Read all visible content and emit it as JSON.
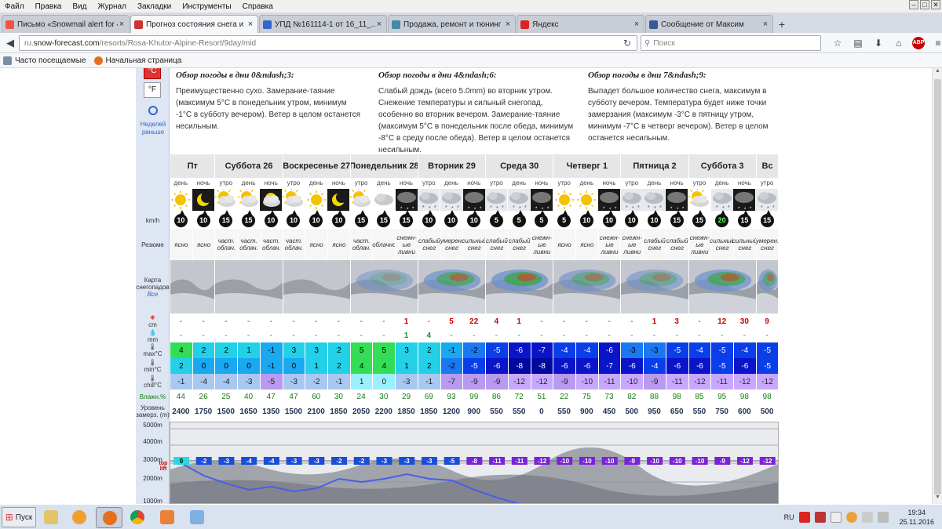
{
  "menu": [
    "Файл",
    "Правка",
    "Вид",
    "Журнал",
    "Закладки",
    "Инструменты",
    "Справка"
  ],
  "tabs": [
    {
      "label": "Письмо «Snowmail alert for 4...",
      "color": "#e54",
      "active": false
    },
    {
      "label": "Прогноз состояния снега и ...",
      "color": "#c33",
      "active": true
    },
    {
      "label": "УПД №161114-1 от 16_11_...",
      "color": "#36c",
      "active": false
    },
    {
      "label": "Продажа, ремонт и тюнинг ...",
      "color": "#48a",
      "active": false
    },
    {
      "label": "Яндекс",
      "color": "#d22",
      "active": false
    },
    {
      "label": "Сообщение от Максим",
      "color": "#3b5998",
      "active": false
    }
  ],
  "url": {
    "prefix": "ru.",
    "host": "snow-forecast.com",
    "path": "/resorts/Rosa-Khutor-Alpine-Resort/9day/mid"
  },
  "search_placeholder": "Поиск",
  "bookmarks": [
    "Часто посещаемые",
    "Начальная страница"
  ],
  "units": {
    "c": "°C",
    "f": "°F"
  },
  "prev_days": "Неделей раньше",
  "overview": [
    {
      "title": "Обзор погоды в дни 0&ndash;3:",
      "text": "Преимущественно сухо. Замерание-таяние (максимум 5°C в понедельник утром, минимум -1°C в субботу вечером). Ветер в целом останется несильным."
    },
    {
      "title": "Обзор погоды в дни 4&ndash;6:",
      "text": "Слабый дождь (всего 5.0mm) во вторник утром. Снежение температуры и сильный снегопад, особенно во вторник вечером. Замерание-таяние (максимум 5°C в понедельник после обеда, минимум -8°C в среду после обеда). Ветер в целом останется несильным."
    },
    {
      "title": "Обзор погоды в дни 7&ndash;9:",
      "text": "Выпадет большое количество снега, максимум в субботу вечером. Температура будет ниже точки замерзания (максимум -3°C в пятницу утром, минимум -7°C в четверг вечером). Ветер в целом останется несильным."
    }
  ],
  "row_labels": {
    "wind": "km/h",
    "summary": "Резюме",
    "map": "Карта снегопадов",
    "map_all": "Все",
    "snow": "cm",
    "rain": "mm",
    "tmax": "max°C",
    "tmin": "min°C",
    "chill": "chill°C",
    "hum": "Влажн.%",
    "frz": "Уровень замерз. (m)"
  },
  "days": [
    {
      "name": "Пт",
      "periods": 2
    },
    {
      "name": "Суббота 26",
      "periods": 3
    },
    {
      "name": "Воскресенье 27",
      "periods": 3
    },
    {
      "name": "Понедельник 28",
      "periods": 3
    },
    {
      "name": "Вторник 29",
      "periods": 3
    },
    {
      "name": "Среда 30",
      "periods": 3
    },
    {
      "name": "Четверг 1",
      "periods": 3
    },
    {
      "name": "Пятница 2",
      "periods": 3
    },
    {
      "name": "Суббота 3",
      "periods": 3
    },
    {
      "name": "Вс",
      "periods": 1
    }
  ],
  "columns": [
    {
      "tod": "день",
      "icon": "sun",
      "wind": "10",
      "sum": "ясно",
      "snow": "-",
      "rain": "-",
      "tmax": "4",
      "tmin": "2",
      "chill": "-1",
      "hum": "44",
      "frz": "2400"
    },
    {
      "tod": "ночь",
      "icon": "moon",
      "wind": "10",
      "sum": "ясно",
      "snow": "-",
      "rain": "-",
      "tmax": "2",
      "tmin": "0",
      "chill": "-4",
      "hum": "26",
      "frz": "1750"
    },
    {
      "tod": "утро",
      "icon": "sun-cloud",
      "wind": "15",
      "sum": "част. облач.",
      "snow": "-",
      "rain": "-",
      "tmax": "2",
      "tmin": "0",
      "chill": "-4",
      "hum": "25",
      "frz": "1500"
    },
    {
      "tod": "день",
      "icon": "sun-cloud",
      "wind": "15",
      "sum": "част. облач.",
      "snow": "-",
      "rain": "-",
      "tmax": "1",
      "tmin": "0",
      "chill": "-3",
      "hum": "40",
      "frz": "1650"
    },
    {
      "tod": "ночь",
      "icon": "moon-cloud",
      "wind": "10",
      "sum": "част. облач.",
      "snow": "-",
      "rain": "-",
      "tmax": "-1",
      "tmin": "-1",
      "chill": "-5",
      "hum": "47",
      "frz": "1350"
    },
    {
      "tod": "утро",
      "icon": "sun-cloud",
      "wind": "10",
      "sum": "част. облач.",
      "snow": "-",
      "rain": "-",
      "tmax": "3",
      "tmin": "0",
      "chill": "-3",
      "hum": "47",
      "frz": "1500"
    },
    {
      "tod": "день",
      "icon": "sun",
      "wind": "10",
      "sum": "ясно",
      "snow": "-",
      "rain": "-",
      "tmax": "3",
      "tmin": "1",
      "chill": "-2",
      "hum": "60",
      "frz": "2100"
    },
    {
      "tod": "ночь",
      "icon": "moon",
      "wind": "10",
      "sum": "ясно",
      "snow": "-",
      "rain": "-",
      "tmax": "2",
      "tmin": "2",
      "chill": "-1",
      "hum": "30",
      "frz": "1850"
    },
    {
      "tod": "утро",
      "icon": "sun-cloud",
      "wind": "15",
      "sum": "част. облач.",
      "snow": "-",
      "rain": "-",
      "tmax": "5",
      "tmin": "4",
      "chill": "1",
      "hum": "24",
      "frz": "2050"
    },
    {
      "tod": "день",
      "icon": "cloud",
      "wind": "15",
      "sum": "облачно",
      "snow": "-",
      "rain": "-",
      "tmax": "5",
      "tmin": "4",
      "chill": "0",
      "hum": "30",
      "frz": "2200"
    },
    {
      "tod": "ночь",
      "icon": "snow-night",
      "wind": "15",
      "sum": "снежн-ые ливни",
      "snow": "1",
      "rain": "1",
      "tmax": "3",
      "tmin": "1",
      "chill": "-3",
      "hum": "29",
      "frz": "1850"
    },
    {
      "tod": "утро",
      "icon": "snow",
      "wind": "10",
      "sum": "слабый снег",
      "snow": "-",
      "rain": "4",
      "tmax": "2",
      "tmin": "2",
      "chill": "-1",
      "hum": "69",
      "frz": "1850"
    },
    {
      "tod": "день",
      "icon": "snow",
      "wind": "10",
      "sum": "умерен. снег",
      "snow": "5",
      "rain": "-",
      "tmax": "-1",
      "tmin": "-2",
      "chill": "-7",
      "hum": "93",
      "frz": "1200"
    },
    {
      "tod": "ночь",
      "icon": "snow-night",
      "wind": "10",
      "sum": "сильный снег",
      "snow": "22",
      "rain": "-",
      "tmax": "-2",
      "tmin": "-5",
      "chill": "-9",
      "hum": "99",
      "frz": "900"
    },
    {
      "tod": "утро",
      "icon": "snow",
      "wind": "5",
      "sum": "слабый снег",
      "snow": "4",
      "rain": "-",
      "tmax": "-5",
      "tmin": "-6",
      "chill": "-9",
      "hum": "86",
      "frz": "550"
    },
    {
      "tod": "день",
      "icon": "snow",
      "wind": "5",
      "sum": "слабый снег",
      "snow": "1",
      "rain": "-",
      "tmax": "-6",
      "tmin": "-8",
      "chill": "-12",
      "hum": "72",
      "frz": "550"
    },
    {
      "tod": "ночь",
      "icon": "snow-night",
      "wind": "5",
      "sum": "снежн-ые ливни",
      "snow": "-",
      "rain": "-",
      "tmax": "-7",
      "tmin": "-8",
      "chill": "-12",
      "hum": "51",
      "frz": "0"
    },
    {
      "tod": "утро",
      "icon": "sun",
      "wind": "5",
      "sum": "ясно",
      "snow": "-",
      "rain": "-",
      "tmax": "-4",
      "tmin": "-6",
      "chill": "-9",
      "hum": "22",
      "frz": "550"
    },
    {
      "tod": "день",
      "icon": "sun",
      "wind": "10",
      "sum": "ясно",
      "snow": "-",
      "rain": "-",
      "tmax": "-4",
      "tmin": "-6",
      "chill": "-10",
      "hum": "75",
      "frz": "900"
    },
    {
      "tod": "ночь",
      "icon": "snow-night",
      "wind": "10",
      "sum": "снежн-ые ливни",
      "snow": "-",
      "rain": "-",
      "tmax": "-6",
      "tmin": "-7",
      "chill": "-11",
      "hum": "73",
      "frz": "450"
    },
    {
      "tod": "утро",
      "icon": "snow",
      "wind": "10",
      "sum": "снежн-ые ливни",
      "snow": "-",
      "rain": "-",
      "tmax": "-3",
      "tmin": "-6",
      "chill": "-10",
      "hum": "82",
      "frz": "500"
    },
    {
      "tod": "день",
      "icon": "snow",
      "wind": "10",
      "sum": "слабый снег",
      "snow": "1",
      "rain": "-",
      "tmax": "-3",
      "tmin": "-4",
      "chill": "-9",
      "hum": "88",
      "frz": "950"
    },
    {
      "tod": "ночь",
      "icon": "snow-night",
      "wind": "15",
      "sum": "слабый снег",
      "snow": "3",
      "rain": "-",
      "tmax": "-5",
      "tmin": "-6",
      "chill": "-11",
      "hum": "98",
      "frz": "650"
    },
    {
      "tod": "утро",
      "icon": "sun-cloud",
      "wind": "15",
      "sum": "снежн-ые ливни",
      "snow": "-",
      "rain": "-",
      "tmax": "-4",
      "tmin": "-6",
      "chill": "-12",
      "hum": "85",
      "frz": "550"
    },
    {
      "tod": "день",
      "icon": "snow",
      "wind": "20",
      "sum": "сильный снег",
      "snow": "12",
      "rain": "-",
      "tmax": "-5",
      "tmin": "-5",
      "chill": "-11",
      "hum": "95",
      "frz": "750"
    },
    {
      "tod": "ночь",
      "icon": "snow-night",
      "wind": "15",
      "sum": "сильный снег",
      "snow": "30",
      "rain": "-",
      "tmax": "-4",
      "tmin": "-6",
      "chill": "-12",
      "hum": "98",
      "frz": "600"
    },
    {
      "tod": "утро",
      "icon": "snow",
      "wind": "15",
      "sum": "умерен. снег",
      "snow": "9",
      "rain": "-",
      "tmax": "-5",
      "tmin": "-5",
      "chill": "-12",
      "hum": "98",
      "frz": "500"
    }
  ],
  "chart": {
    "alt_labels": [
      "5000m",
      "4000m",
      "3000m",
      "2000m",
      "1000m"
    ],
    "top_lift": "top lift",
    "badges": [
      "0",
      "-2",
      "-3",
      "-4",
      "-4",
      "-3",
      "-3",
      "-2",
      "-2",
      "-3",
      "-3",
      "-3",
      "-5",
      "-8",
      "-11",
      "-11",
      "-12",
      "-10",
      "-10",
      "-10",
      "-9",
      "-10",
      "-10",
      "-10",
      "-9",
      "-12",
      "-12"
    ]
  },
  "taskbar": {
    "start": "Пуск",
    "lang": "RU",
    "time": "19:34",
    "date": "25.11.2016"
  }
}
